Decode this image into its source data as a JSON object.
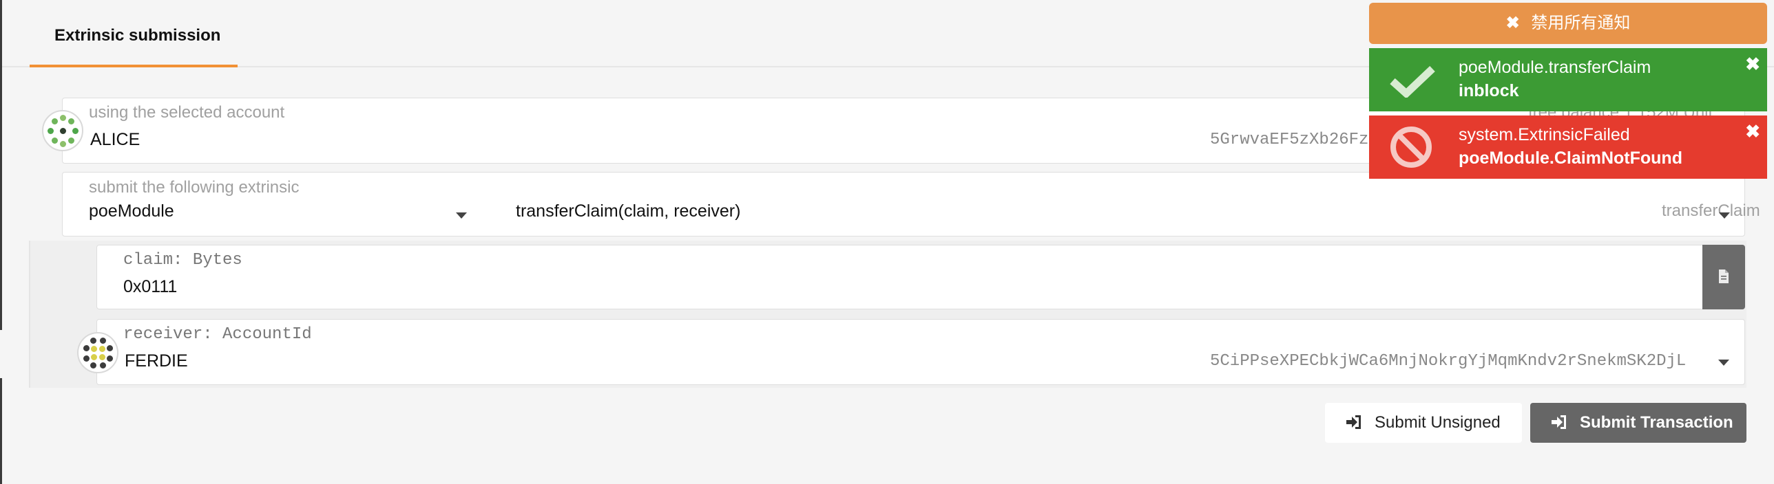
{
  "tabs": [
    {
      "label": "Extrinsic submission"
    }
  ],
  "account": {
    "label": "using the selected account",
    "name": "ALICE",
    "address": "5GrwvaEF5zXb26Fz",
    "balance_partial": "free balance 1.152M Unit",
    "balance_tail": "1.152M Unit"
  },
  "extrinsic": {
    "label": "submit the following extrinsic",
    "module": "poeModule",
    "signature": "transferClaim(claim, receiver)",
    "method": "transferClaim"
  },
  "params": {
    "claim": {
      "label": "claim: Bytes",
      "value": "0x0111"
    },
    "receiver": {
      "label": "receiver: AccountId",
      "name": "FERDIE",
      "address": "5CiPPseXPECbkjWCa6MnjNokrgYjMqmKndv2rSnekmSK2DjL"
    }
  },
  "actions": {
    "unsigned_label": "Submit Unsigned",
    "submit_label": "Submit Transaction"
  },
  "notifications": {
    "dismiss_all": "禁用所有通知",
    "items": [
      {
        "status": "success",
        "title": "poeModule.transferClaim",
        "subtitle": "inblock"
      },
      {
        "status": "error",
        "title": "system.ExtrinsicFailed",
        "subtitle": "poeModule.ClaimNotFound"
      }
    ]
  },
  "colors": {
    "accent": "#f19135",
    "toast_orange": "#e8944a",
    "toast_green": "#3c9b34",
    "toast_red": "#e53b2e",
    "submit_button": "#666666"
  },
  "icons": [
    "close-icon",
    "check-icon",
    "ban-icon",
    "file-icon",
    "sign-in-icon",
    "dropdown-caret-icon"
  ]
}
